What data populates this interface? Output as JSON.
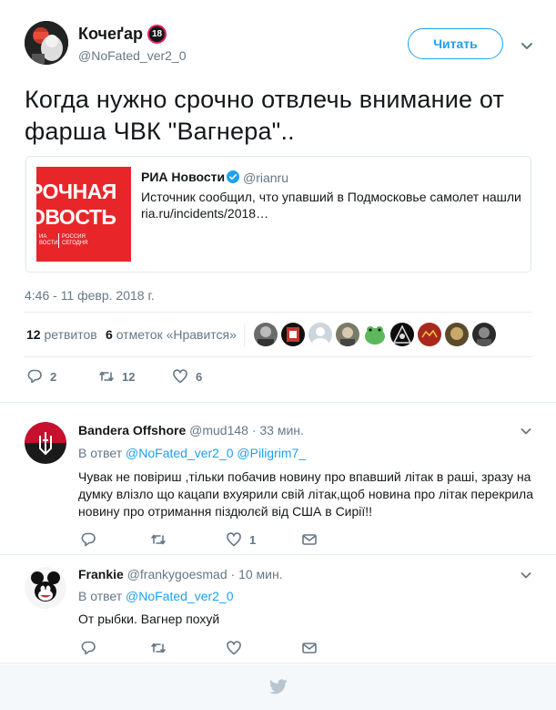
{
  "main": {
    "display_name": "Кочеґар",
    "badge": "18",
    "handle": "@NoFated_ver2_0",
    "follow_label": "Читать",
    "text": "Когда нужно срочно отвлечь внимание от фарша ЧВК \"Вагнера\"..",
    "card": {
      "image_line1": "РОЧНАЯ",
      "image_line2": "ОВОСТЬ",
      "image_small1": "ИА\nВОСТИ",
      "image_small2": "РОССИЯ\nСЕГОДНЯ",
      "source_name": "РИА Новости",
      "source_handle": "@rianru",
      "text": "Источник сообщил, что упавший в Подмосковье самолет нашли",
      "link": "ria.ru/incidents/2018…"
    },
    "date": "4:46 - 11 февр. 2018 г.",
    "retweets_count": "12",
    "retweets_label": "ретвитов",
    "likes_count": "6",
    "likes_label": "отметок «Нравится»",
    "actions": {
      "replies": "2",
      "retweets": "12",
      "likes": "6"
    }
  },
  "replies": [
    {
      "name": "Bandera Offshore",
      "handle": "@mud148",
      "time": "· 33 мин.",
      "in_reply_prefix": "В ответ",
      "mentions": "@NoFated_ver2_0 @Piligrim7_",
      "text": "Чувак не повіриш ,тільки побачив новину про впавший літак в раші, зразу на думку влізло що кацапи вхуярили свій літак,щоб  новина про літак перекрила новину про отримання піздюлєй від США в Сирії!!",
      "actions": {
        "replies": "",
        "retweets": "",
        "likes": "1"
      }
    },
    {
      "name": "Frankie",
      "handle": "@frankygoesmad",
      "time": "· 10 мин.",
      "in_reply_prefix": "В ответ",
      "mentions": "@NoFated_ver2_0",
      "text": "От рыбки. Вагнер похуй",
      "actions": {
        "replies": "",
        "retweets": "",
        "likes": ""
      }
    }
  ],
  "icons": {
    "reply": "reply-icon",
    "retweet": "retweet-icon",
    "like": "heart-icon",
    "dm": "envelope-icon",
    "caret": "chevron-down-icon",
    "verified": "verified-badge-icon",
    "footer": "twitter-bird-icon"
  },
  "colors": {
    "accent": "#1da1f2",
    "secondary_text": "#657786",
    "border": "#e6ecf0",
    "card_red": "#e8262a"
  }
}
